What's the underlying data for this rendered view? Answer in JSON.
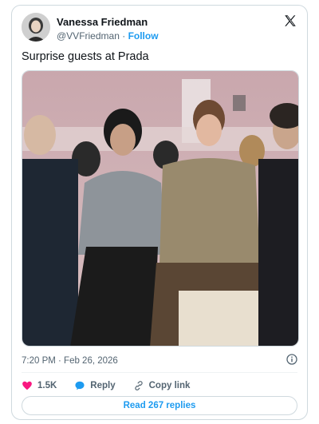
{
  "author": {
    "name": "Vanessa Friedman",
    "handle": "@VVFriedman",
    "separator": "·",
    "follow_label": "Follow"
  },
  "tweet": {
    "text": "Surprise guests at Prada",
    "timestamp": "7:20 PM · Feb 26, 2026"
  },
  "actions": {
    "likes": "1.5K",
    "reply_label": "Reply",
    "copy_label": "Copy link",
    "read_replies_label": "Read 267 replies"
  },
  "colors": {
    "accent": "#1d9bf0",
    "like": "#f91880",
    "muted": "#536471",
    "border": "#cfd9de"
  },
  "icons": [
    "x-logo-icon",
    "heart-icon",
    "reply-bubble-icon",
    "link-icon",
    "info-icon"
  ]
}
